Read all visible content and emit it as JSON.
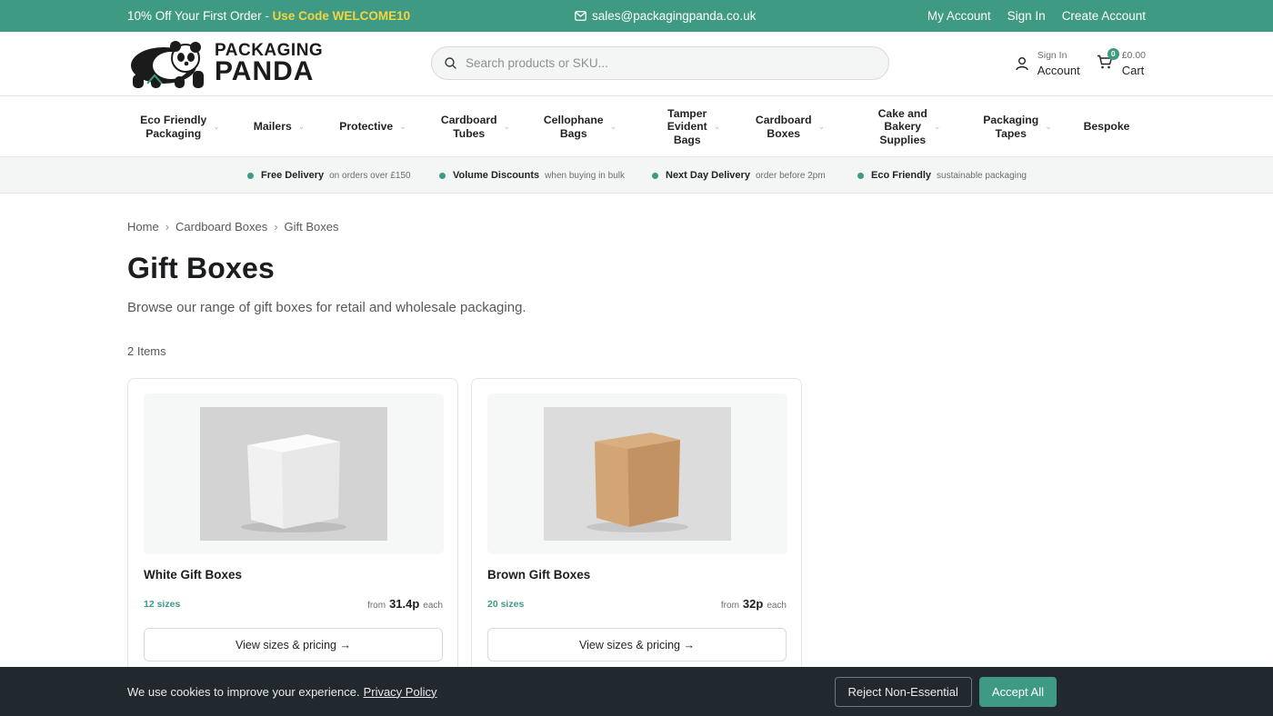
{
  "topbar": {
    "promo_text": "10% Off Your First Order - ",
    "promo_code": "Use Code WELCOME10",
    "email": "sales@packagingpanda.co.uk",
    "links": [
      "My Account",
      "Sign In",
      "Create Account"
    ]
  },
  "header": {
    "logo_line1": "PACKAGING",
    "logo_line2": "PANDA",
    "search_placeholder": "Search products or SKU...",
    "account_small": "Sign In",
    "account_big": "Account",
    "cart_count": "0",
    "cart_total": "£0.00",
    "cart_label": "Cart"
  },
  "nav": {
    "items": [
      {
        "label": "Eco Friendly\nPackaging",
        "has_menu": true
      },
      {
        "label": "Mailers",
        "has_menu": true
      },
      {
        "label": "Protective",
        "has_menu": true
      },
      {
        "label": "Cardboard\nTubes",
        "has_menu": true
      },
      {
        "label": "Cellophane\nBags",
        "has_menu": true
      },
      {
        "label": "Tamper\nEvident\nBags",
        "has_menu": true
      },
      {
        "label": "Cardboard\nBoxes",
        "has_menu": true
      },
      {
        "label": "Cake and\nBakery\nSupplies",
        "has_menu": true
      },
      {
        "label": "Packaging\nTapes",
        "has_menu": true
      },
      {
        "label": "Bespoke",
        "has_menu": false
      }
    ]
  },
  "benefits": [
    {
      "title": "Free Delivery",
      "detail": "on orders over £150"
    },
    {
      "title": "Volume Discounts",
      "detail": "when buying in bulk"
    },
    {
      "title": "Next Day Delivery",
      "detail": "order before 2pm"
    },
    {
      "title": "Eco Friendly",
      "detail": "sustainable packaging"
    }
  ],
  "breadcrumb": [
    "Home",
    "Cardboard Boxes",
    "Gift Boxes"
  ],
  "page": {
    "title": "Gift Boxes",
    "description": "Browse our range of gift boxes for retail and wholesale packaging.",
    "item_count": "2 Items"
  },
  "products": [
    {
      "name": "White Gift Boxes",
      "sizes": "12 sizes",
      "from": "from",
      "price": "31.4p",
      "each": "each",
      "button": "View sizes & pricing →",
      "box_color": "#f7f7f7",
      "box_shade": "#e4e4e4"
    },
    {
      "name": "Brown Gift Boxes",
      "sizes": "20 sizes",
      "from": "from",
      "price": "32p",
      "each": "each",
      "button": "View sizes & pricing →",
      "box_color": "#d4a87a",
      "box_shade": "#c0905e"
    }
  ],
  "cookie": {
    "text": "We use cookies to improve your experience.",
    "link": "Privacy Policy",
    "reject": "Reject Non-Essential",
    "accept": "Accept All"
  },
  "colors": {
    "brand": "#3f9a84",
    "promo_code": "#f6d43c",
    "cookie_bg": "#21292e"
  }
}
